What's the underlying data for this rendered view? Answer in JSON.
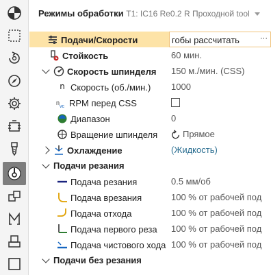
{
  "header": {
    "title": "Режимы обработки",
    "tool": "T1: IC16 Re0.2 R Проходной tool"
  },
  "toolbar": [
    {
      "name": "setup-icon"
    },
    {
      "name": "stock-icon"
    },
    {
      "name": "rotate-tool-icon"
    },
    {
      "name": "compass-icon"
    },
    {
      "name": "gear-icon"
    },
    {
      "name": "fixture-icon"
    },
    {
      "name": "drill-tool-icon"
    },
    {
      "name": "feeds-speeds-icon",
      "active": true
    },
    {
      "name": "passes-icon"
    },
    {
      "name": "linking-icon"
    },
    {
      "name": "post-icon"
    },
    {
      "name": "square-icon"
    }
  ],
  "rows": [
    {
      "label": "Подачи/Скорости",
      "value": "гобы рассчитать",
      "extra": "···",
      "bold": true,
      "selected": true,
      "icon": "feeds-icon"
    },
    {
      "label": "Стойкость",
      "value": "60 мин.",
      "bold": true,
      "icon": "tool-life-icon"
    },
    {
      "label": "Скорость шпинделя",
      "value": "150 м./мин. (CSS)",
      "bold": true,
      "expanded": true,
      "icon": "spindle-speed-icon"
    },
    {
      "label": "Скорость (об./мин.)",
      "value": "1000",
      "icon": "rpm-icon"
    },
    {
      "label": "RPM перед CSS",
      "value": "",
      "checkbox": true,
      "icon": "rpm-before-css-icon"
    },
    {
      "label": "Диапазон",
      "value": "0",
      "icon": "range-icon"
    },
    {
      "label": "Вращение шпинделя",
      "value": "Прямое",
      "valueIcon": "rotate-icon",
      "icon": "spindle-rotation-icon"
    },
    {
      "label": "Охлаждение",
      "value": "(Жидкость)",
      "bold": true,
      "collapsed": true,
      "link": true,
      "icon": "coolant-icon"
    },
    {
      "label": "Подачи резания",
      "value": "",
      "bold": true,
      "expanded": true,
      "group": true
    },
    {
      "label": "Подача резания",
      "value": "0.5 мм/об",
      "icon": "cutting-feed-icon"
    },
    {
      "label": "Подача врезания",
      "value": "100 % от рабочей под",
      "icon": "plunge-feed-icon"
    },
    {
      "label": "Подача отхода",
      "value": "100 % от рабочей под",
      "icon": "retract-feed-icon"
    },
    {
      "label": "Подача первого реза",
      "value": "100 % от рабочей под",
      "icon": "first-cut-feed-icon"
    },
    {
      "label": "Подача чистового хода",
      "value": "100 % от рабочей под",
      "icon": "finish-feed-icon"
    },
    {
      "label": "Подачи без резания",
      "value": "",
      "bold": true,
      "expanded": true,
      "group": true
    }
  ]
}
